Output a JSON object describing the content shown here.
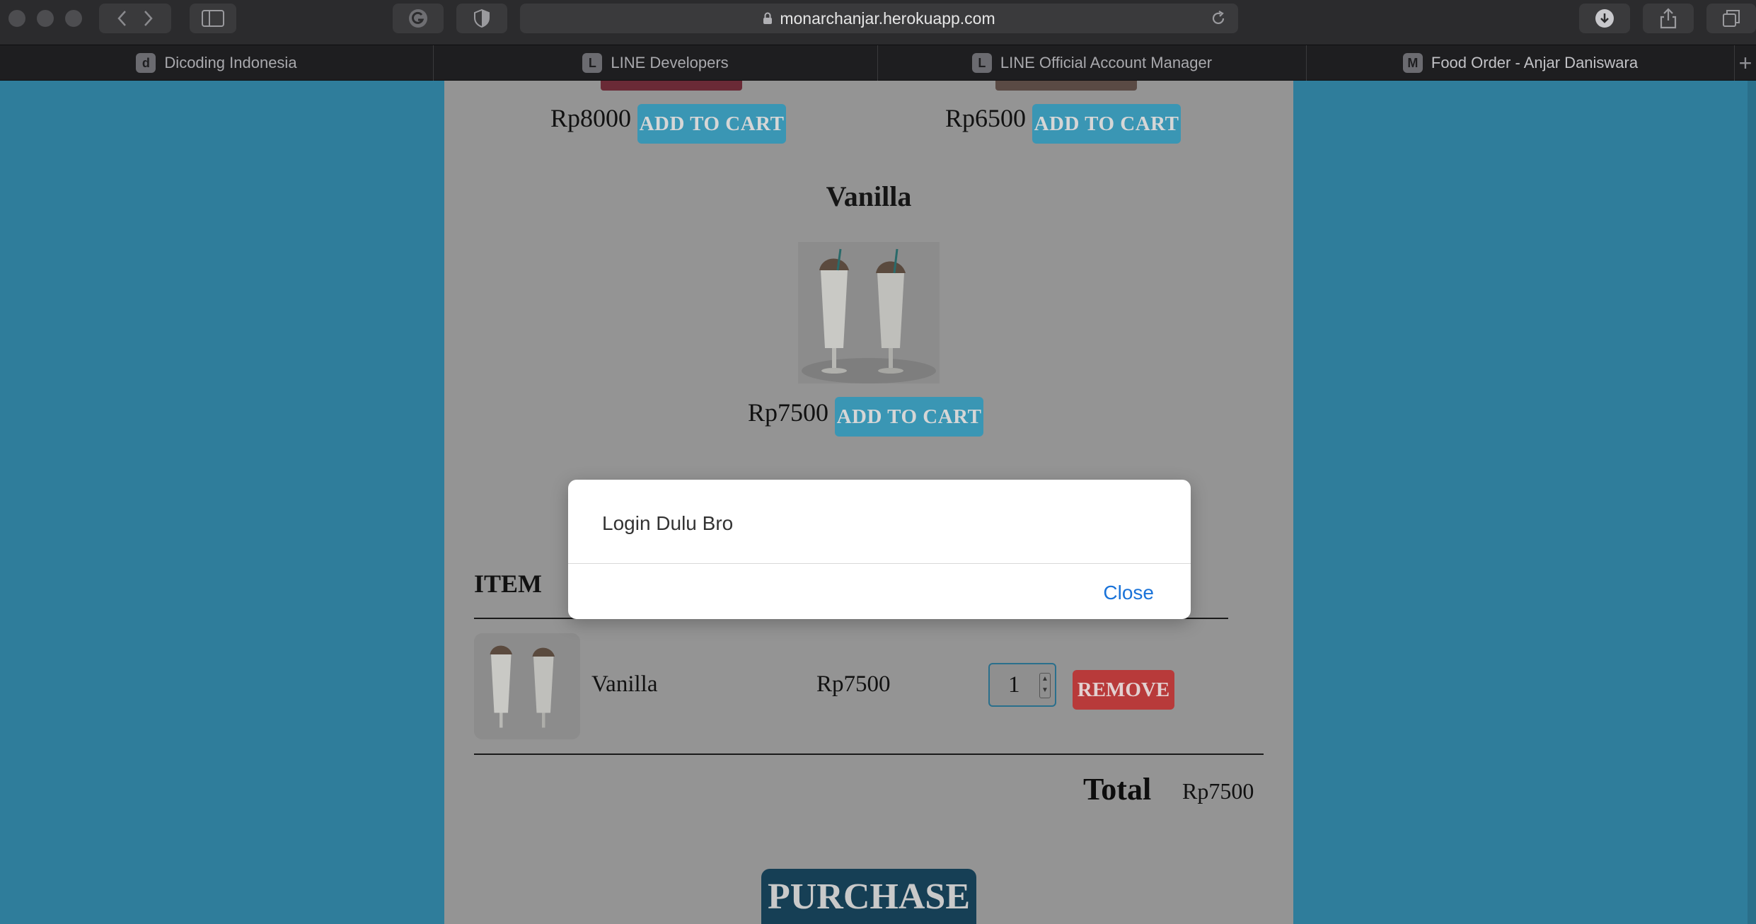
{
  "browser": {
    "url": "monarchanjar.herokuapp.com",
    "tabs": [
      {
        "label": "Dicoding Indonesia",
        "favicon": "d"
      },
      {
        "label": "LINE Developers",
        "favicon": "L"
      },
      {
        "label": "LINE Official Account Manager",
        "favicon": "L"
      },
      {
        "label": "Food Order - Anjar Daniswara",
        "favicon": "M"
      }
    ]
  },
  "products": {
    "top_left": {
      "price": "Rp8000",
      "button": "ADD TO CART"
    },
    "top_right": {
      "price": "Rp6500",
      "button": "ADD TO CART"
    },
    "vanilla": {
      "name": "Vanilla",
      "price": "Rp7500",
      "button": "ADD TO CART"
    }
  },
  "cart": {
    "header": "ITEM",
    "items": [
      {
        "name": "Vanilla",
        "price": "Rp7500",
        "quantity": "1",
        "remove_label": "REMOVE"
      }
    ],
    "total_label": "Total",
    "total_value": "Rp7500",
    "purchase_label": "PURCHASE"
  },
  "modal": {
    "message": "Login Dulu Bro",
    "close_label": "Close"
  },
  "colors": {
    "page_background": "#3aa0c6",
    "content_background": "#f3f3f3",
    "add_to_cart": "#3aa0c4",
    "remove": "#e04040",
    "purchase": "#1b4f6b",
    "close_link": "#1a73d9"
  }
}
